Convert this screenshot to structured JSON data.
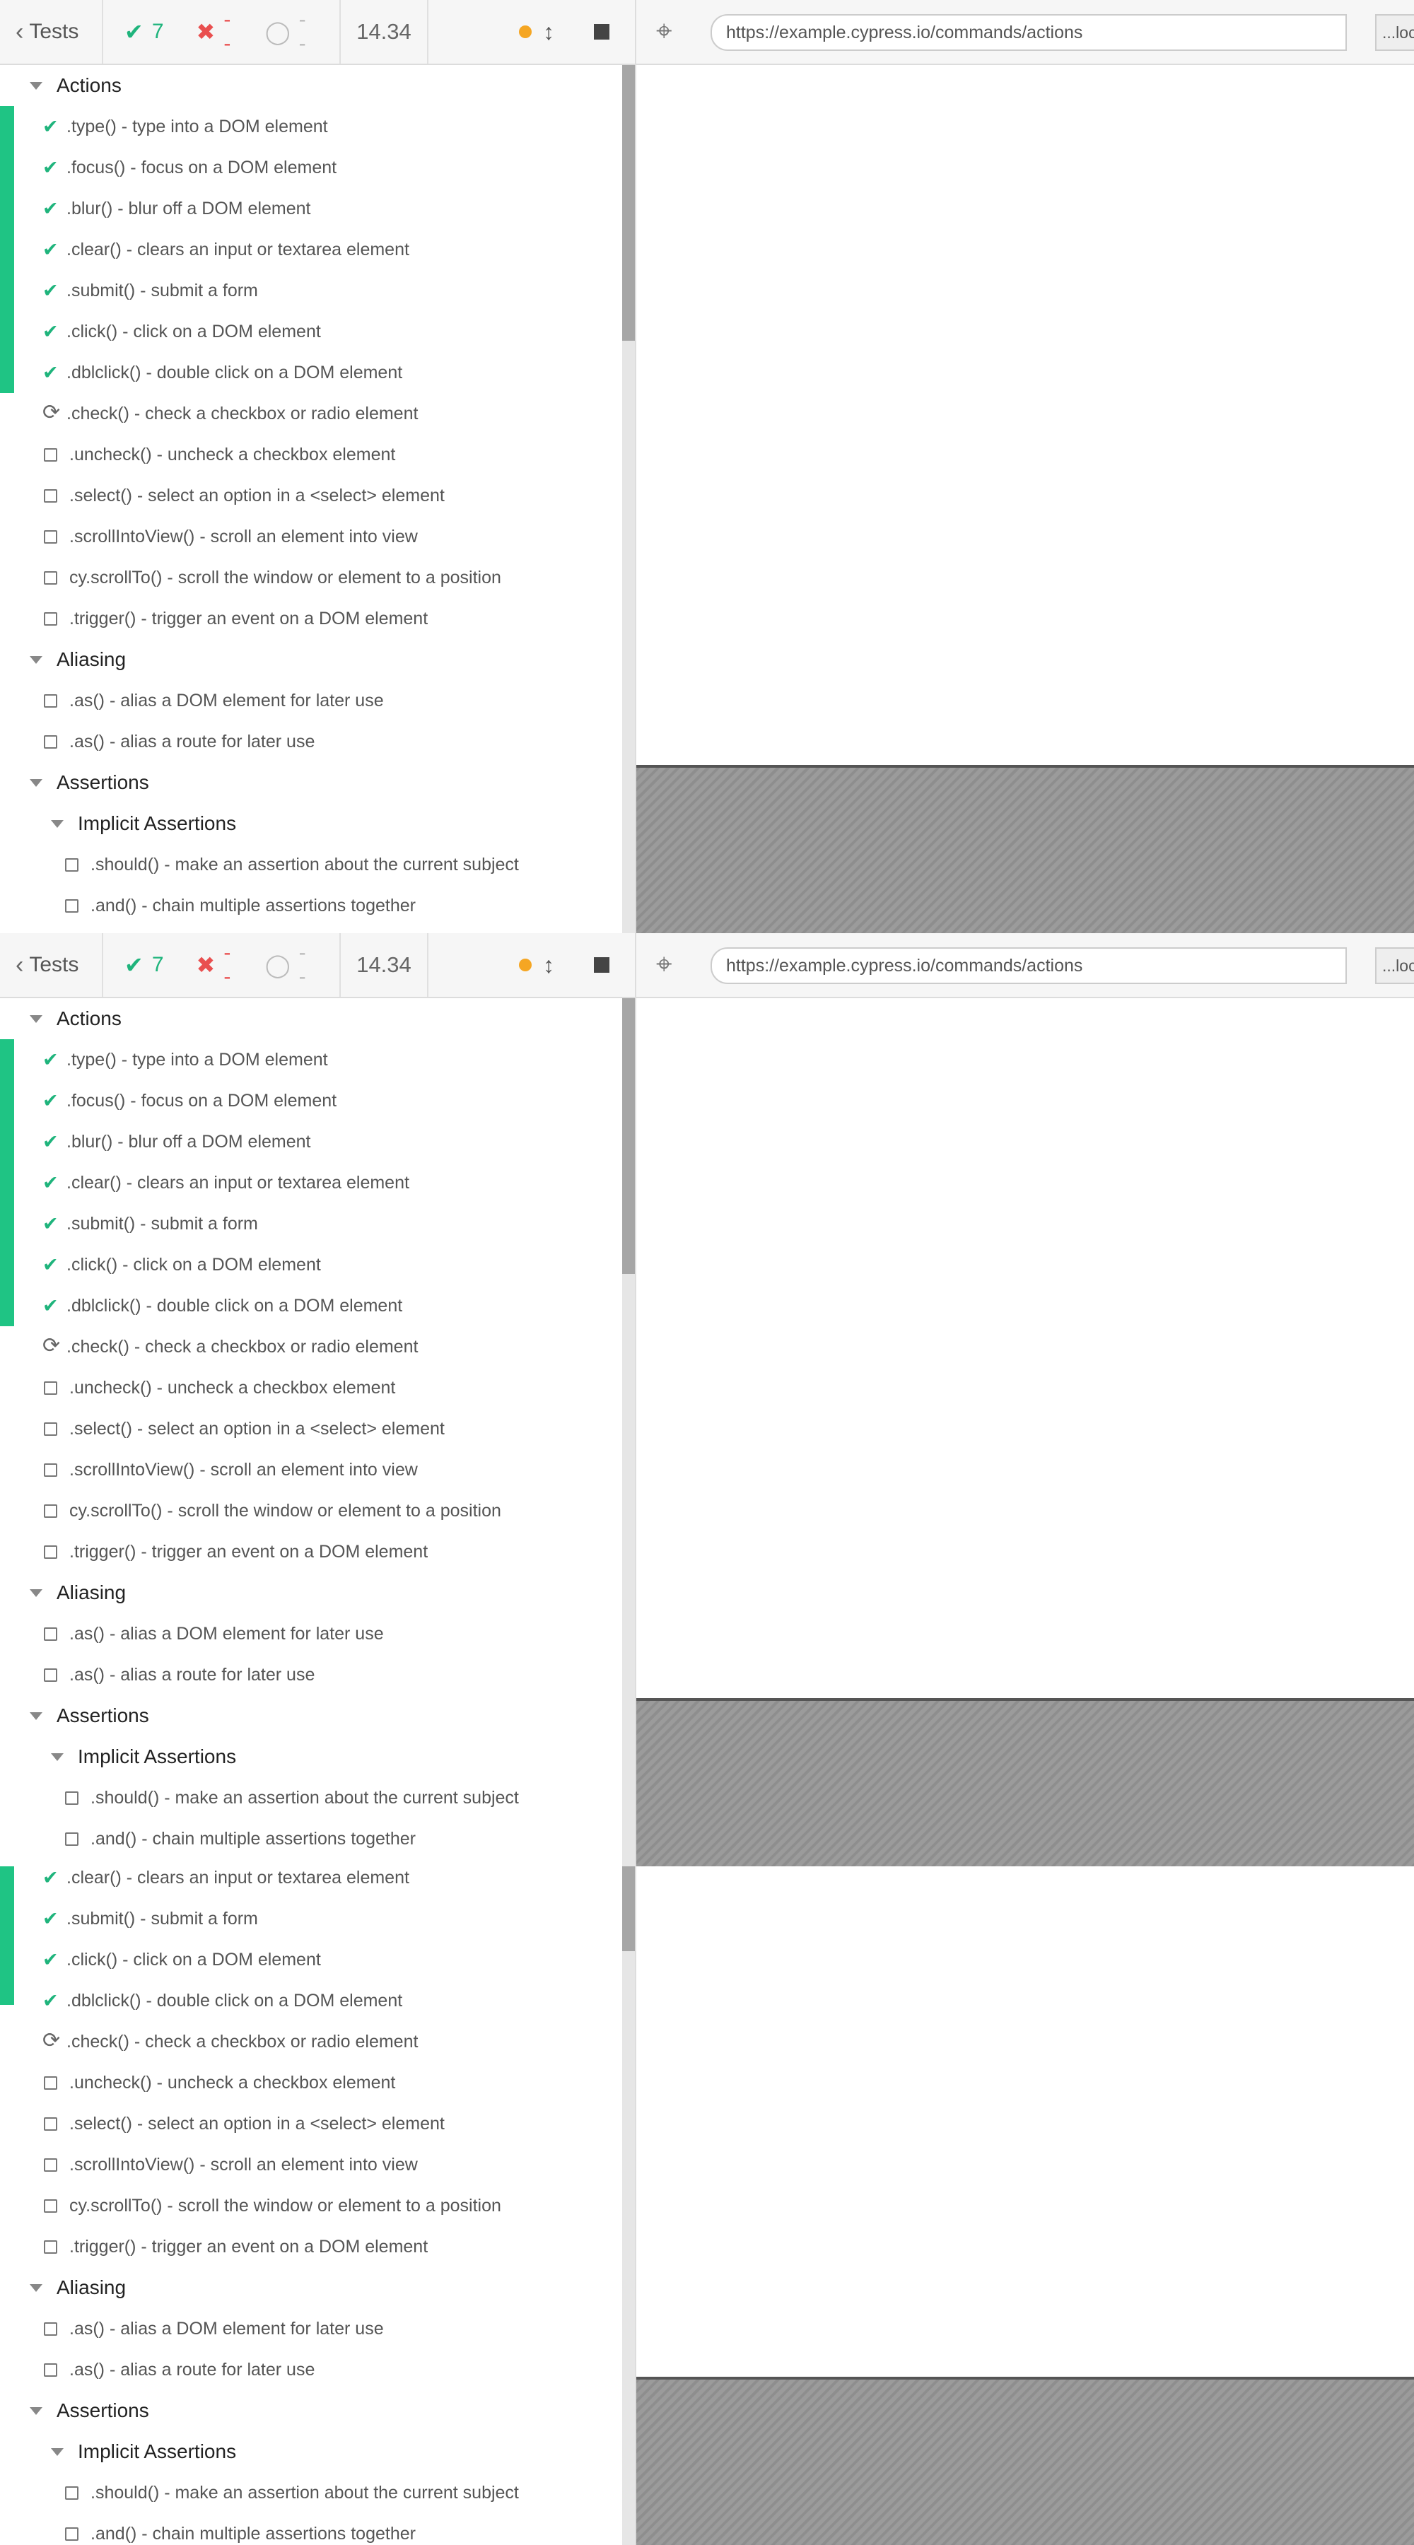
{
  "header": {
    "tests_label": "Tests",
    "passed_count": "7",
    "failed_count": "--",
    "pending_count": "--",
    "duration": "14.34"
  },
  "app": {
    "url": "https://example.cypress.io/commands/actions",
    "url_more": "...loc"
  },
  "colors": {
    "passed": "#1fb47c",
    "failed": "#e94f4f",
    "running_dot": "#f5a623",
    "passed_bar": "#1fc484"
  },
  "icons": [
    "chevron-left-icon",
    "check-icon",
    "x-icon",
    "circle-icon",
    "status-dot-icon",
    "vertical-expand-icon",
    "stop-icon",
    "target-crosshair-icon",
    "caret-down-icon",
    "checkbox-icon",
    "refresh-icon"
  ],
  "suites": {
    "actions": "Actions",
    "aliasing": "Aliasing",
    "assertions": "Assertions",
    "implicit": "Implicit Assertions"
  },
  "tests": [
    ".type() - type into a DOM element",
    ".focus() - focus on a DOM element",
    ".blur() - blur off a DOM element",
    ".clear() - clears an input or textarea element",
    ".submit() - submit a form",
    ".click() - click on a DOM element",
    ".dblclick() - double click on a DOM element",
    ".check() - check a checkbox or radio element",
    ".uncheck() - uncheck a checkbox element",
    ".select() - select an option in a <select> element",
    ".scrollIntoView() - scroll an element into view",
    "cy.scrollTo() - scroll the window or element to a position",
    ".trigger() - trigger an event on a DOM element",
    ".as() - alias a DOM element for later use",
    ".as() - alias a route for later use",
    ".should() - make an assertion about the current subject",
    ".and() - chain multiple assertions together"
  ]
}
